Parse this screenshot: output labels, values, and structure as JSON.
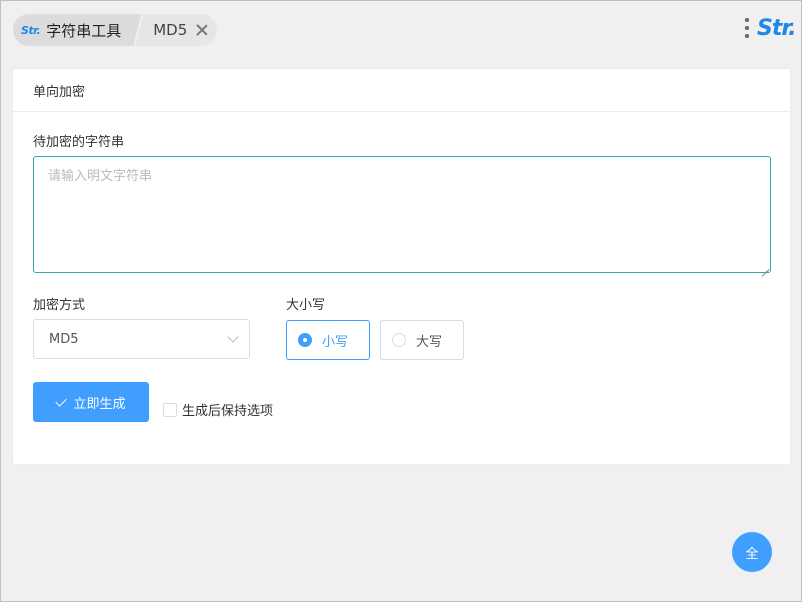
{
  "header": {
    "crumb_logo": "Str.",
    "crumb_home": "字符串工具",
    "crumb_current": "MD5",
    "brand_logo": "Str."
  },
  "card": {
    "title": "单向加密",
    "input": {
      "label": "待加密的字符串",
      "placeholder": "请输入明文字符串",
      "value": ""
    },
    "method": {
      "label": "加密方式",
      "selected": "MD5"
    },
    "case": {
      "label": "大小写",
      "options": [
        "小写",
        "大写"
      ],
      "selected": "小写"
    },
    "generate_label": "立即生成",
    "keep_option_label": "生成后保持选项",
    "keep_option_checked": false
  },
  "fab_label": "全",
  "colors": {
    "primary": "#409eff",
    "focus_border": "#3aa6a6",
    "logo": "#1e88e5"
  }
}
